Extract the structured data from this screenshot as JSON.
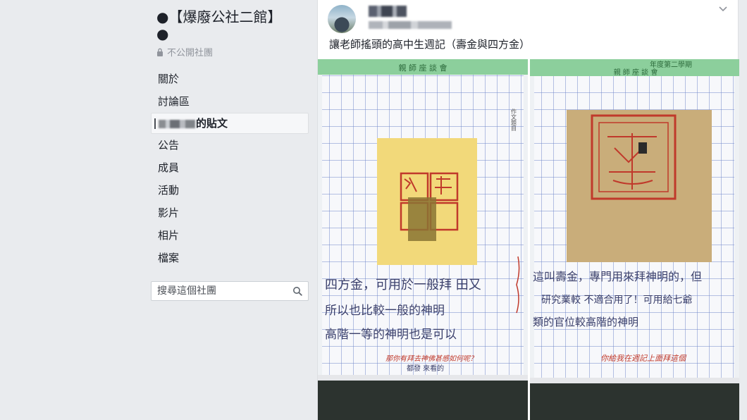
{
  "group": {
    "title": "●【爆廢公社二館】●",
    "privacy": "不公開社團"
  },
  "nav": [
    {
      "label": "關於"
    },
    {
      "label": "討論區"
    },
    {
      "label": "的貼文",
      "active": true
    },
    {
      "label": "公告"
    },
    {
      "label": "成員"
    },
    {
      "label": "活動"
    },
    {
      "label": "影片"
    },
    {
      "label": "相片"
    },
    {
      "label": "檔案"
    }
  ],
  "search": {
    "placeholder": "搜尋這個社團"
  },
  "post": {
    "text": "讓老師搖頭的高中生週記（壽金與四方金）"
  },
  "photo1": {
    "header": "親 師 座 談 會",
    "line1": "四方金，可用於一般拜 田又",
    "line2": "所以也比較一般的神明",
    "line3": "高階一等的神明也是可以",
    "teacher_note": "那你有拜去神佛甚感如何呢？",
    "teacher_sign": "都發 來看的",
    "side_note": "作文題目"
  },
  "photo2": {
    "header_top": "年度第二學期",
    "header": "親 師 座 談 會",
    "line1": "這叫壽金，專門用來拜神明的，但",
    "line2": "研究業較 不適合用了！可用給七爺",
    "line3": "類的官位較高階的神明",
    "teacher_note": "你給我在週記上面拜這個"
  },
  "colors": {
    "background": "#e9ebee",
    "card": "#ffffff",
    "border": "#dddfe2",
    "muted_text": "#90949c",
    "text": "#1d2129",
    "grid_line": "#6a80c8",
    "paper_yellow": "#f2d97a",
    "paper_tan": "#c9ad7a",
    "seal_red": "#c0392b",
    "pen_ink": "#3a3f6b",
    "teacher_ink": "#c0392b"
  },
  "icons": {
    "lock": "lock-icon",
    "search": "search-icon",
    "chevron": "chevron-down-icon"
  }
}
